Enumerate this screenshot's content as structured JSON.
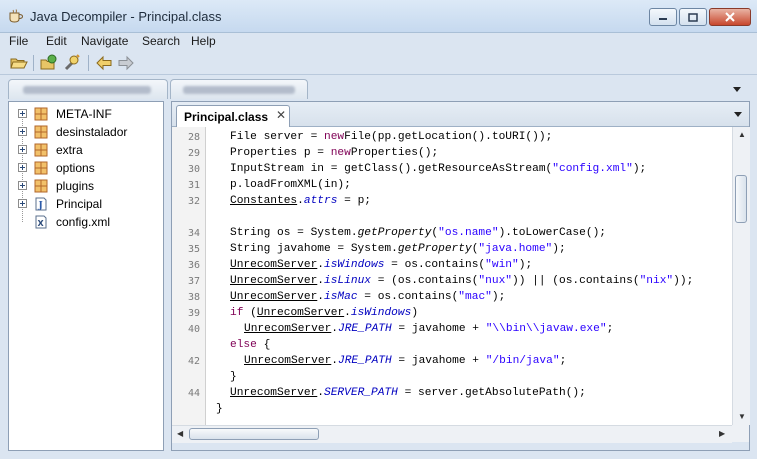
{
  "window": {
    "title": "Java Decompiler - Principal.class"
  },
  "menu": [
    "File",
    "Edit",
    "Navigate",
    "Search",
    "Help"
  ],
  "toolbar": {
    "icons": [
      "open-file-icon",
      "open-type-icon",
      "search-type-icon",
      "back-icon",
      "forward-icon"
    ]
  },
  "outer_tabs": {
    "count": 2
  },
  "tree": {
    "items": [
      {
        "label": "META-INF",
        "type": "package"
      },
      {
        "label": "desinstalador",
        "type": "package"
      },
      {
        "label": "extra",
        "type": "package"
      },
      {
        "label": "options",
        "type": "package"
      },
      {
        "label": "plugins",
        "type": "package"
      },
      {
        "label": "Principal",
        "type": "java"
      },
      {
        "label": "config.xml",
        "type": "xml"
      }
    ]
  },
  "editor": {
    "tab_label": "Principal.class",
    "line_numbers": [
      "28",
      "29",
      "30",
      "31",
      "32",
      "34",
      "35",
      "36",
      "37",
      "38",
      "39",
      "40",
      "42",
      "44"
    ]
  },
  "colors": {
    "keyword": "#7f0055",
    "string": "#2a00ff",
    "static_field": "#0000c0"
  }
}
